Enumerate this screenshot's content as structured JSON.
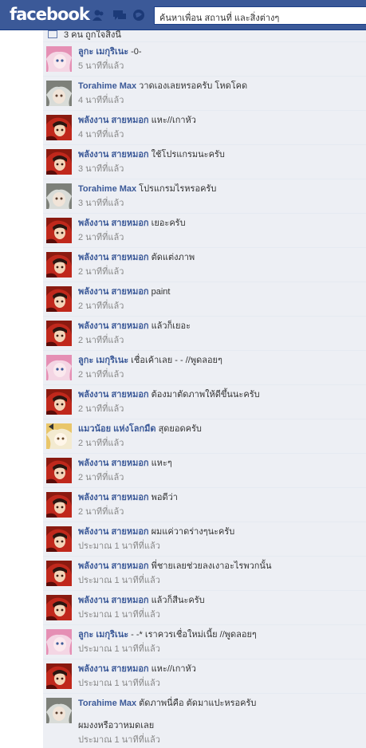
{
  "topbar": {
    "logo": "facebook",
    "search_value": "ค้นหาเพื่อน สถานที่ และสิ่งต่างๆ",
    "jewels": [
      "friend-requests-icon",
      "messages-icon",
      "notifications-icon"
    ]
  },
  "likes": {
    "text": "3 คน ถูกใจสิ่งนี้"
  },
  "colors": {
    "bar": "#3b5998",
    "author": "#3b5998",
    "stream_bg": "#edeff4",
    "timestamp": "#888888"
  },
  "comments": [
    {
      "author": "ลูกะ เมกุริเนะ",
      "text": "-0-",
      "time": "5 นาทีที่แล้ว",
      "avatar": "pink"
    },
    {
      "author": "Torahime Max",
      "text": "วาดเองเลยหรอครับ โหดโคด",
      "time": "4 นาทีที่แล้ว",
      "avatar": "gray"
    },
    {
      "author": "พลังงาน สายหมอก",
      "text": "แหะ//เกาหัว",
      "time": "4 นาทีที่แล้ว",
      "avatar": "red"
    },
    {
      "author": "พลังงาน สายหมอก",
      "text": "ใช้โปรแกรมนะครับ",
      "time": "3 นาทีที่แล้ว",
      "avatar": "red"
    },
    {
      "author": "Torahime Max",
      "text": "โปรแกรมไรหรอครับ",
      "time": "3 นาทีที่แล้ว",
      "avatar": "gray"
    },
    {
      "author": "พลังงาน สายหมอก",
      "text": "เยอะครับ",
      "time": "2 นาทีที่แล้ว",
      "avatar": "red"
    },
    {
      "author": "พลังงาน สายหมอก",
      "text": "ตัดแต่งภาพ",
      "time": "2 นาทีที่แล้ว",
      "avatar": "red"
    },
    {
      "author": "พลังงาน สายหมอก",
      "text": "paint",
      "time": "2 นาทีที่แล้ว",
      "avatar": "red"
    },
    {
      "author": "พลังงาน สายหมอก",
      "text": "แล้วก็เยอะ",
      "time": "2 นาทีที่แล้ว",
      "avatar": "red"
    },
    {
      "author": "ลูกะ เมกุริเนะ",
      "text": "เชื่อเค้าเลย - - //พูดลอยๆ",
      "time": "2 นาทีที่แล้ว",
      "avatar": "pink"
    },
    {
      "author": "พลังงาน สายหมอก",
      "text": "ต้องมาตัดภาพให้ดีขึ้นนะครับ",
      "time": "2 นาทีที่แล้ว",
      "avatar": "red"
    },
    {
      "author": "แมวน้อย แห่งโลกมืด",
      "text": "สุดยอดครับ",
      "time": "2 นาทีที่แล้ว",
      "avatar": "yellow"
    },
    {
      "author": "พลังงาน สายหมอก",
      "text": "แหะๆ",
      "time": "2 นาทีที่แล้ว",
      "avatar": "red"
    },
    {
      "author": "พลังงาน สายหมอก",
      "text": "พอดีว่า",
      "time": "2 นาทีที่แล้ว",
      "avatar": "red"
    },
    {
      "author": "พลังงาน สายหมอก",
      "text": "ผมแค่วาดร่างๆนะครับ",
      "time": "ประมาณ 1 นาทีที่แล้ว",
      "avatar": "red"
    },
    {
      "author": "พลังงาน สายหมอก",
      "text": "พี่ชายเลยช่วยลงเงาอะไรพวกนั้น",
      "time": "ประมาณ 1 นาทีที่แล้ว",
      "avatar": "red"
    },
    {
      "author": "พลังงาน สายหมอก",
      "text": "แล้วก็สีนะครับ",
      "time": "ประมาณ 1 นาทีที่แล้ว",
      "avatar": "red"
    },
    {
      "author": "ลูกะ เมกุริเนะ",
      "text": "- -* เราควรเชื่อใหม่เนี้ย //พูดลอยๆ",
      "time": "ประมาณ 1 นาทีที่แล้ว",
      "avatar": "pink"
    },
    {
      "author": "พลังงาน สายหมอก",
      "text": "แหะ//เกาหัว",
      "time": "ประมาณ 1 นาทีที่แล้ว",
      "avatar": "red"
    },
    {
      "author": "Torahime Max",
      "text": "ตัดภาพนี่คือ ตัดมาแปะหรอครับ",
      "extra": "ผมงงหรือวาหมดเลย",
      "time": "ประมาณ 1 นาทีที่แล้ว",
      "avatar": "gray"
    }
  ]
}
